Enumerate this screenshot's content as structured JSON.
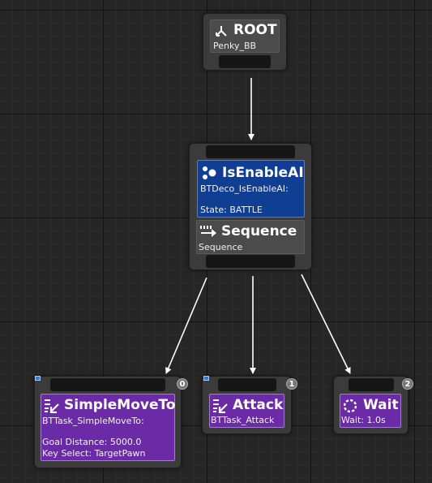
{
  "root": {
    "title": "ROOT",
    "blackboard": "Penky_BB"
  },
  "composite": {
    "decorator": {
      "title": "IsEnableAI",
      "class_name": "BTDeco_IsEnableAI:",
      "state": "State: BATTLE"
    },
    "sequence": {
      "title": "Sequence",
      "subtitle": "Sequence"
    }
  },
  "tasks": [
    {
      "index": "0",
      "title": "SimpleMoveTo",
      "class_name": "BTTask_SimpleMoveTo:",
      "detail1": "Goal Distance: 5000.0",
      "detail2": "Key Select: TargetPawn"
    },
    {
      "index": "1",
      "title": "Attack",
      "class_name": "BTTask_Attack"
    },
    {
      "index": "2",
      "title": "Wait",
      "detail": "Wait: 1.0s"
    }
  ],
  "icons": {
    "root": "tree-branch-icon",
    "decorator": "decorator-dots-icon",
    "sequence": "sequence-arrows-icon",
    "task": "task-list-arrow-icon",
    "wait": "wait-dotted-circle-icon"
  },
  "colors": {
    "graph_background": "#262626",
    "node_background": "#3b3b3b",
    "decorator_blue": "#0f3e92",
    "task_purple": "#6b2ba6",
    "wire": "#ffffff"
  }
}
